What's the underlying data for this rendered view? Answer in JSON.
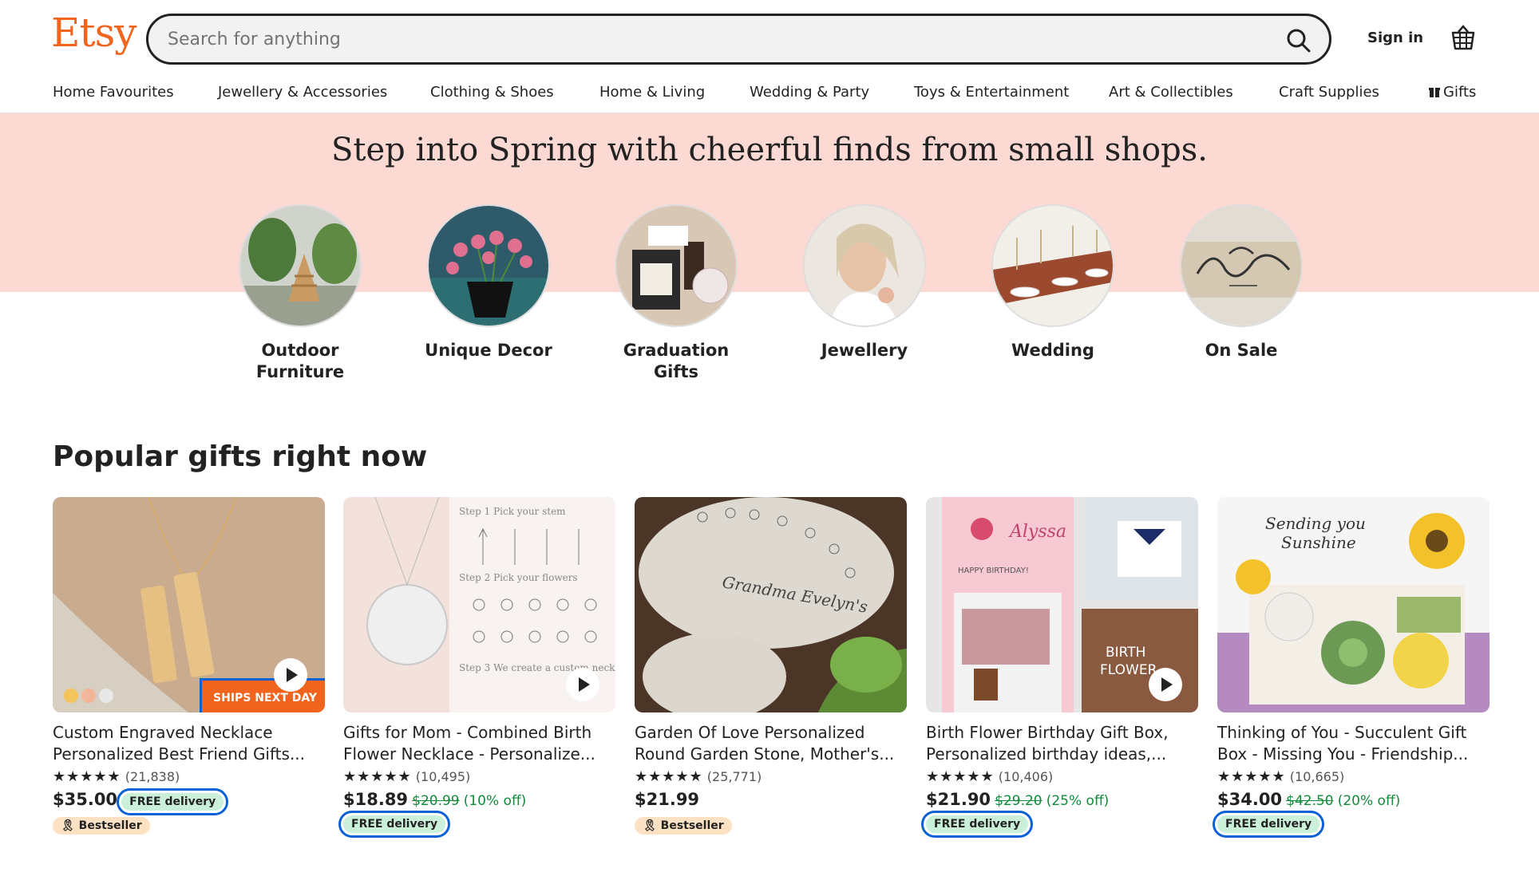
{
  "brand": {
    "logo": "Etsy",
    "accent": "#F1641E"
  },
  "search": {
    "placeholder": "Search for anything"
  },
  "header": {
    "signin": "Sign in"
  },
  "nav": [
    "Home Favourites",
    "Jewellery & Accessories",
    "Clothing & Shoes",
    "Home & Living",
    "Wedding & Party",
    "Toys & Entertainment",
    "Art & Collectibles",
    "Craft Supplies",
    "Gifts"
  ],
  "banner": {
    "title": "Step into Spring with cheerful finds from small shops.",
    "categories": [
      {
        "label": "Outdoor Furniture"
      },
      {
        "label": "Unique Decor"
      },
      {
        "label": "Graduation Gifts"
      },
      {
        "label": "Jewellery"
      },
      {
        "label": "Wedding"
      },
      {
        "label": "On Sale"
      }
    ]
  },
  "popular": {
    "title": "Popular gifts right now",
    "items": [
      {
        "title": "Custom Engraved Necklace Personalized Best Friend Gifts...",
        "stars": "★★★★★",
        "reviews": "(21,838)",
        "price": "$35.00",
        "original": "",
        "discount": "",
        "free": "FREE delivery",
        "badge": "Bestseller",
        "ships": "SHIPS NEXT DAY"
      },
      {
        "title": "Gifts for Mom - Combined Birth Flower Necklace - Personalize...",
        "stars": "★★★★★",
        "reviews": "(10,495)",
        "price": "$18.89",
        "original": "$20.99",
        "discount": "(10% off)",
        "free": "FREE delivery",
        "badge": ""
      },
      {
        "title": "Garden Of Love Personalized Round Garden Stone, Mother's...",
        "stars": "★★★★★",
        "reviews": "(25,771)",
        "price": "$21.99",
        "original": "",
        "discount": "",
        "free": "",
        "badge": "Bestseller"
      },
      {
        "title": "Birth Flower Birthday Gift Box, Personalized birthday ideas,...",
        "stars": "★★★★★",
        "reviews": "(10,406)",
        "price": "$21.90",
        "original": "$29.20",
        "discount": "(25% off)",
        "free": "FREE delivery",
        "badge": ""
      },
      {
        "title": "Thinking of You - Succulent Gift Box - Missing You - Friendship...",
        "stars": "★★★★★",
        "reviews": "(10,665)",
        "price": "$34.00",
        "original": "$42.50",
        "discount": "(20% off)",
        "free": "FREE delivery",
        "badge": ""
      }
    ]
  }
}
